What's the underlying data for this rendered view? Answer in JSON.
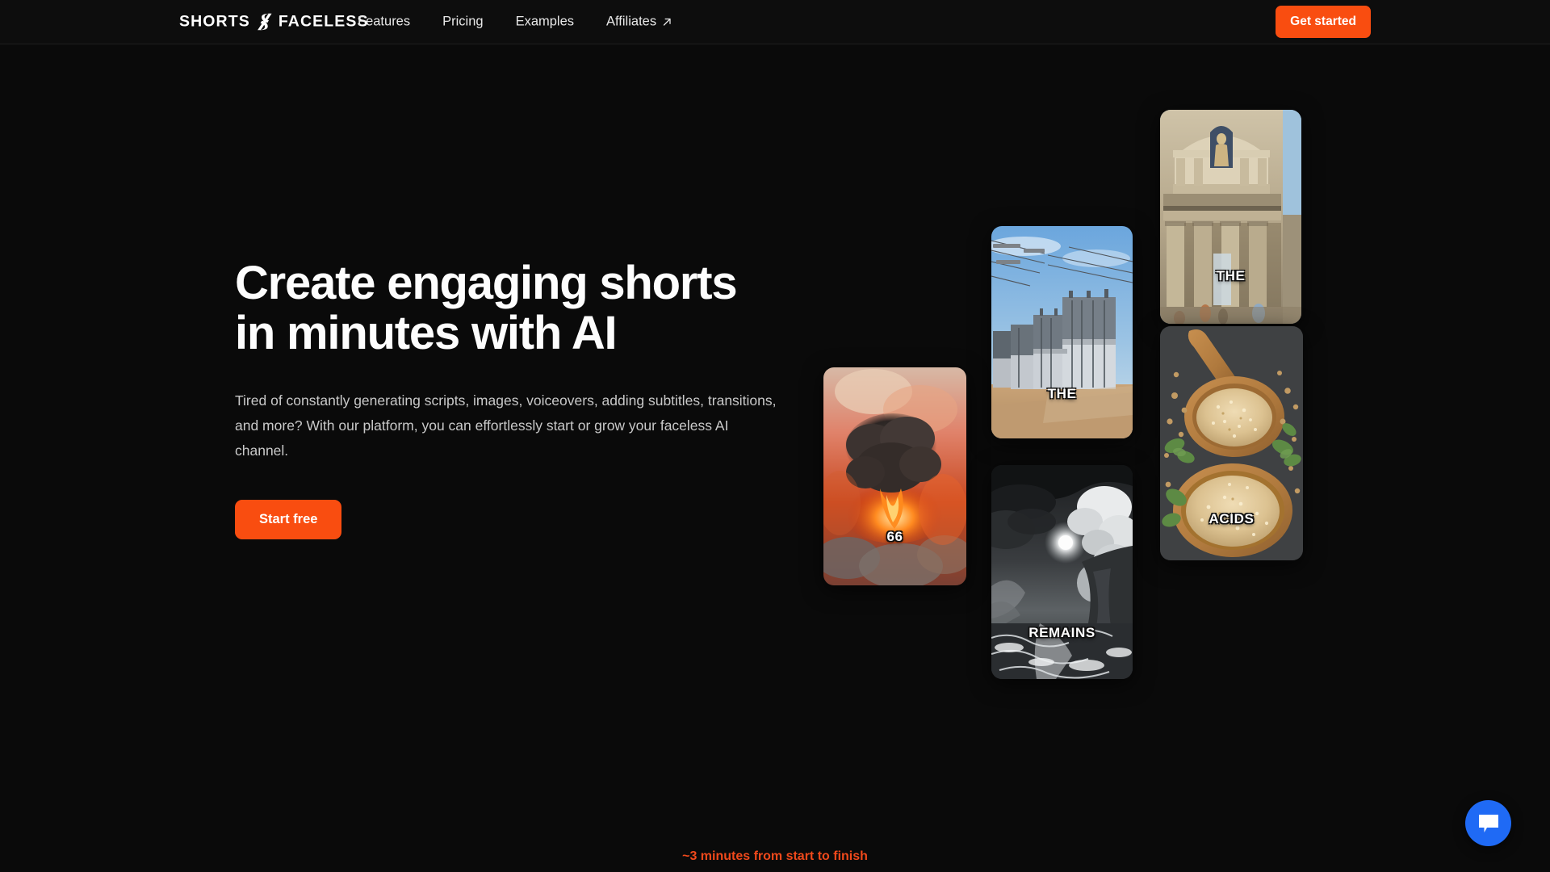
{
  "header": {
    "logo": {
      "text_left": "SHORTS",
      "text_right": "FACELESS",
      "mark_icon": "s-slash-logo-icon"
    },
    "nav": [
      {
        "label": "Features",
        "icon": ""
      },
      {
        "label": "Pricing",
        "icon": ""
      },
      {
        "label": "Examples",
        "icon": ""
      },
      {
        "label": "Affiliates",
        "icon": "external-link-arrow-icon"
      }
    ],
    "cta_label": "Get started"
  },
  "hero": {
    "headline": "Create engaging shorts\nin minutes with AI",
    "subline": "Tired of constantly generating scripts, images, voiceovers, adding subtitles, transitions, and more? With our platform, you can effortlessly start or grow your faceless AI channel.",
    "cta_label": "Start free"
  },
  "cards": [
    {
      "id": "card-66",
      "caption": "66",
      "subject": "volcanic-eruption-mushroom-cloud"
    },
    {
      "id": "card-the1",
      "caption": "THE",
      "subject": "electrical-substation-transformers"
    },
    {
      "id": "card-the2",
      "caption": "THE",
      "subject": "classical-roman-architecture"
    },
    {
      "id": "card-rem",
      "caption": "REMAINS",
      "subject": "monochrome-stormy-seascape"
    },
    {
      "id": "card-acid",
      "caption": "ACIDS",
      "subject": "quinoa-grains-wooden-spoon-bowl"
    }
  ],
  "footnote": "~3 minutes from start to finish",
  "chat": {
    "icon": "chat-bubble-icon"
  },
  "colors": {
    "page_background": "#0a0a0a",
    "accent_orange": "#f94d10",
    "footnote_orange": "#f0491b",
    "chat_blue": "#1f6af5",
    "heading_text": "#fdfdfd",
    "body_text": "#c9c9c9"
  }
}
